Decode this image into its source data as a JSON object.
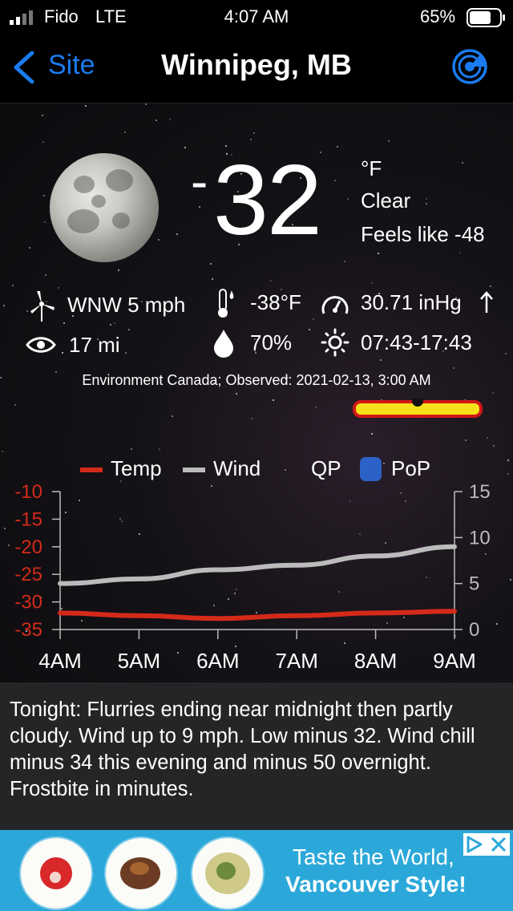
{
  "status_bar": {
    "carrier": "Fido",
    "network": "LTE",
    "time": "4:07 AM",
    "battery": "65%"
  },
  "nav": {
    "back_label": "Site",
    "title": "Winnipeg, MB",
    "radar_icon": "radar-icon"
  },
  "current": {
    "temperature_sign": "-",
    "temperature": "32",
    "unit": "°F",
    "condition": "Clear",
    "feels_like": "Feels like -48",
    "wind": "WNW 5 mph",
    "dewpoint": "-38°F",
    "pressure": "30.71 inHg",
    "pressure_trend_icon": "arrow-up-icon",
    "visibility": "17 mi",
    "humidity": "70%",
    "sun_times": "07:43-17:43",
    "source": "Environment Canada; Observed: 2021-02-13, 3:00 AM"
  },
  "chart_data": {
    "type": "line",
    "legend": [
      "Temp",
      "Wind",
      "QP",
      "PoP"
    ],
    "x": [
      "4AM",
      "5AM",
      "6AM",
      "7AM",
      "8AM",
      "9AM"
    ],
    "y_left_ticks": [
      "-10",
      "-15",
      "-20",
      "-25",
      "-30",
      "-35"
    ],
    "y_right_ticks": [
      "15",
      "10",
      "5",
      "0"
    ],
    "ylim_left": [
      -35,
      -10
    ],
    "ylim_right": [
      0,
      15
    ],
    "series": [
      {
        "name": "Temp",
        "axis": "left",
        "color": "#d42a1a",
        "values": [
          -32,
          -32.5,
          -33,
          -32.5,
          -32,
          -31.7
        ]
      },
      {
        "name": "Wind",
        "axis": "right",
        "color": "#bbbbbb",
        "values": [
          5,
          5.5,
          6.5,
          7,
          8,
          9
        ]
      }
    ],
    "grid": false,
    "legend_placement": "top"
  },
  "forecast": {
    "text": "Tonight:  Flurries ending near midnight then partly cloudy. Wind up to 9 mph. Low minus 32. Wind chill minus 34 this evening and minus 50 overnight. Frostbite in minutes."
  },
  "ad": {
    "line1": "Taste the World,",
    "line2": "Vancouver Style!"
  },
  "colors": {
    "accent": "#1a7cf0",
    "temp_axis": "#d42a1a",
    "banner_fill": "#f6e21a",
    "banner_border": "#d01818",
    "pop_swatch": "#2c62c8",
    "ad_bg": "#2ba8d9"
  }
}
